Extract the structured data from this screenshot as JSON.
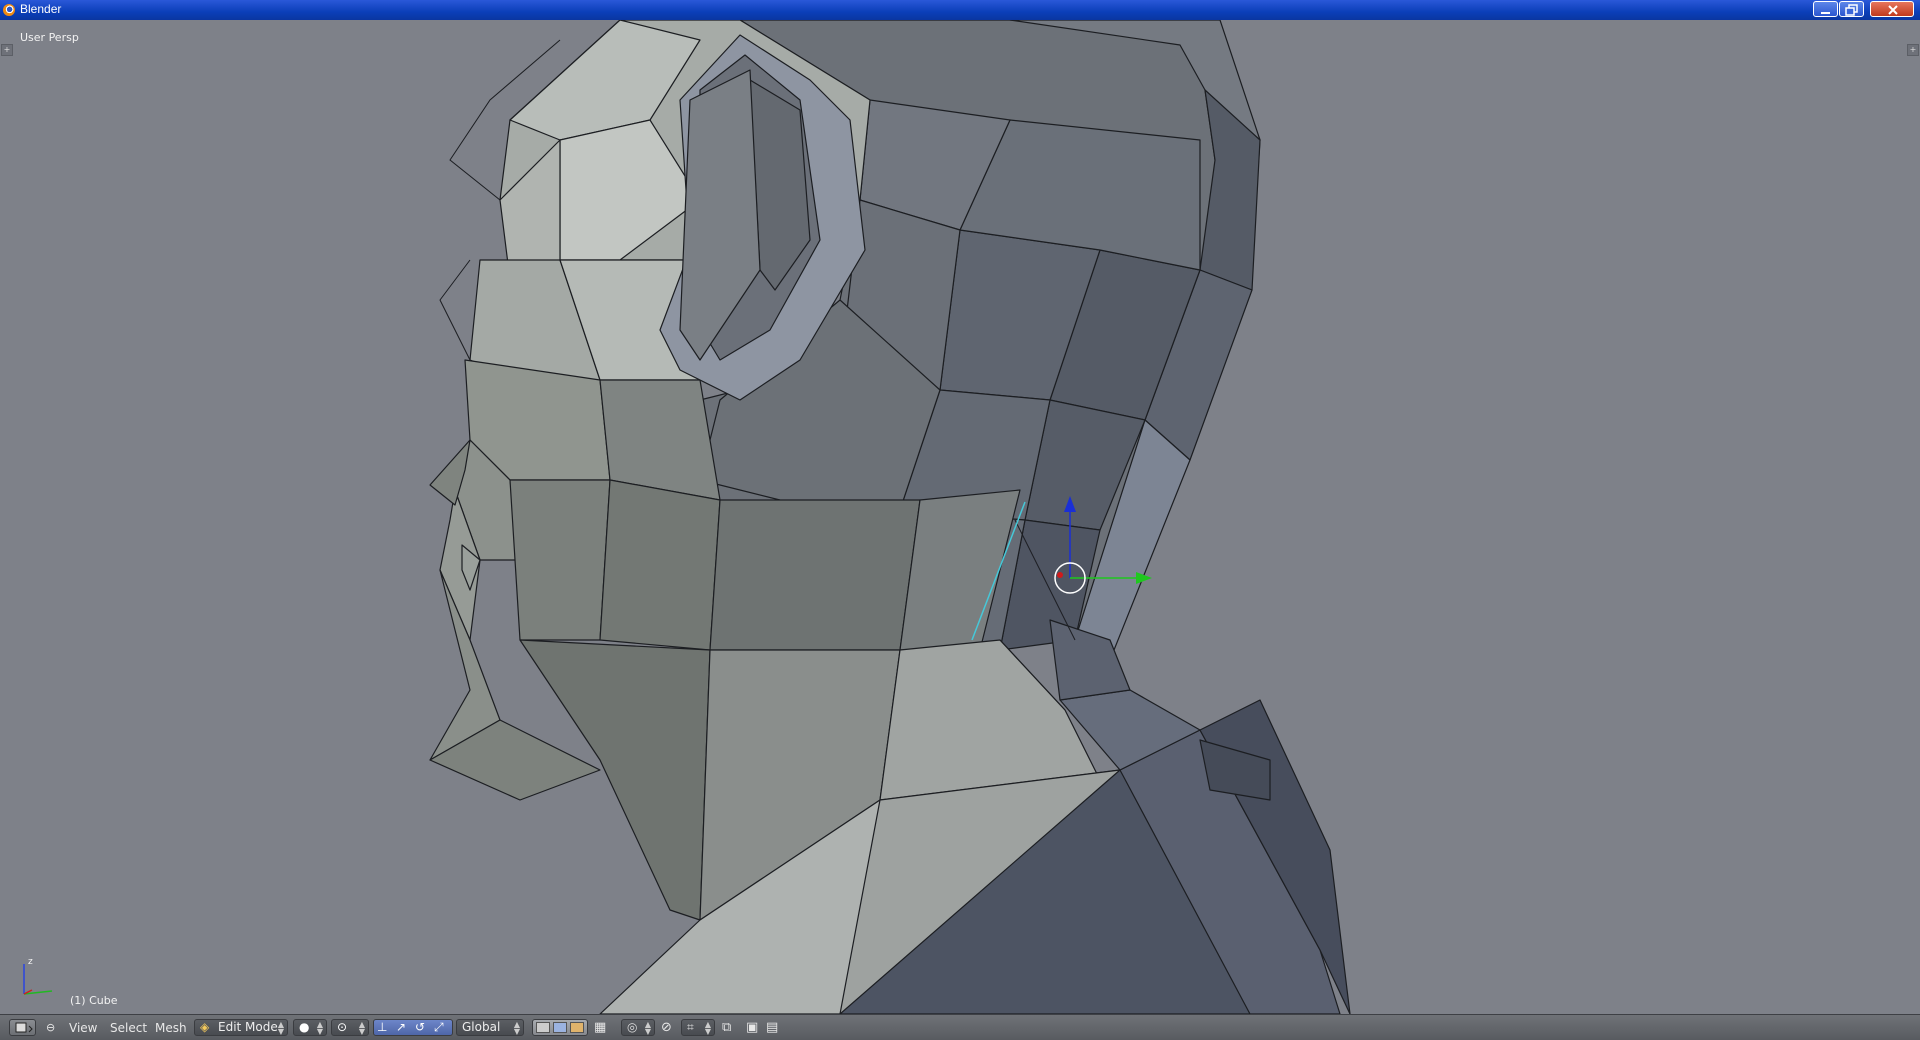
{
  "window": {
    "title": "Blender"
  },
  "viewport": {
    "view_label": "User Persp",
    "object_label": "(1) Cube",
    "axis_labels": {
      "z": "z",
      "x": "x",
      "y": "y"
    }
  },
  "header": {
    "menus": {
      "view": "View",
      "select": "Select",
      "mesh": "Mesh"
    },
    "mode": "Edit Mode",
    "orientation": "Global"
  },
  "colors": {
    "background": "#7e8189",
    "mesh_light": "#a9aeaa",
    "mesh_dark": "#4f5562",
    "selected_edge": "#46c8d8",
    "gizmo_z": "#1a2fd6",
    "gizmo_y": "#1fc81f",
    "gizmo_x": "#d21a1a"
  }
}
